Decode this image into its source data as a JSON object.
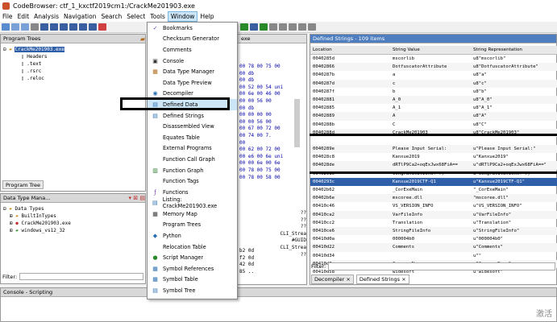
{
  "window": {
    "title": "CodeBrowser: ctf_1_kxctf2019cm1:/CrackMe201903.exe"
  },
  "menu": [
    "File",
    "Edit",
    "Analysis",
    "Navigation",
    "Search",
    "Select",
    "Tools",
    "Window",
    "Help"
  ],
  "program_trees": {
    "title": "Program Trees",
    "root": "CrackMe201903.exe",
    "children": [
      "Headers",
      ".text",
      ".rsrc",
      ".reloc"
    ],
    "tab": "Program Tree"
  },
  "data_type_manager": {
    "title": "Data Type Mana...",
    "root": "Data Types",
    "children": [
      "BuiltInTypes",
      "CrackMe201903.exe",
      "windows_vs12_32"
    ],
    "filter_label": "Filter:"
  },
  "console": {
    "title": "Console - Scripting"
  },
  "listing": {
    "tab": "exe",
    "lines": [
      "00  78 00 75 00",
      "00        db",
      "00        db",
      "00  52 00 54 uni",
      "00  6e 00 46 00",
      "00  00 56 00",
      "00        db",
      "00  00 00 00",
      "00  00 56 00",
      "00  67 00 72 00",
      "00  74 00 7.",
      "00",
      "00  62 00 72 00",
      "00  e6 00 6e uni",
      "00  00 6e 00 6e",
      "00  78 00 75 00",
      "00  78 00 58 00"
    ],
    "lower_lines": [
      "??",
      "??",
      "??",
      "CLI_Strea",
      "#GUID",
      "CLI_Strea",
      "??"
    ],
    "hex_lines": [
      "b2 0d",
      "f2 0d",
      "42 0d",
      "85 .."
    ]
  },
  "window_menu": {
    "items": [
      {
        "label": "Bookmarks",
        "icon": "✓",
        "color": "#6a3fb4"
      },
      {
        "label": "Checksum Generator",
        "icon": "",
        "color": "#000"
      },
      {
        "label": "Comments",
        "icon": "",
        "color": "#000"
      },
      {
        "label": "Console",
        "icon": "▣",
        "color": "#333"
      },
      {
        "label": "Data Type Manager",
        "icon": "▦",
        "color": "#b06a1a"
      },
      {
        "label": "Data Type Preview",
        "icon": "",
        "color": "#000"
      },
      {
        "label": "Decompiler",
        "icon": "◉",
        "color": "#2a6fb0"
      },
      {
        "label": "Defined Data",
        "icon": "▤",
        "color": "#2a6fb0"
      },
      {
        "label": "Defined Strings",
        "icon": "▤",
        "color": "#2a6fb0"
      },
      {
        "label": "Disassembled View",
        "icon": "",
        "color": "#000"
      },
      {
        "label": "Equates Table",
        "icon": "",
        "color": "#000"
      },
      {
        "label": "External Programs",
        "icon": "",
        "color": "#000"
      },
      {
        "label": "Function Call Graph",
        "icon": "",
        "color": "#000"
      },
      {
        "label": "Function Graph",
        "icon": "▥",
        "color": "#2a7a2a"
      },
      {
        "label": "Function Tags",
        "icon": "",
        "color": "#000"
      },
      {
        "label": "Functions",
        "icon": "ƒ",
        "color": "#7a3fb4"
      },
      {
        "label": "Listing: CrackMe201903.exe",
        "icon": "▤",
        "color": "#2a6fb0"
      },
      {
        "label": "Memory Map",
        "icon": "▦",
        "color": "#333"
      },
      {
        "label": "Program Trees",
        "icon": "",
        "color": "#000"
      },
      {
        "label": "Python",
        "icon": "◆",
        "color": "#2a6fb0"
      },
      {
        "label": "Relocation Table",
        "icon": "",
        "color": "#000"
      },
      {
        "label": "Script Manager",
        "icon": "●",
        "color": "#2a8a2a"
      },
      {
        "label": "Symbol References",
        "icon": "▦",
        "color": "#2a6fb0"
      },
      {
        "label": "Symbol Table",
        "icon": "▦",
        "color": "#2a6fb0"
      },
      {
        "label": "Symbol Tree",
        "icon": "▤",
        "color": "#2a6fb0"
      }
    ]
  },
  "defined_strings": {
    "title": "Defined Strings - 109 items",
    "columns": [
      "Location",
      "String Value",
      "String Representation"
    ],
    "rows": [
      [
        "0040285d",
        "mscorlib",
        "u8\"mscorlib\""
      ],
      [
        "00402866",
        "DotfuscatorAttribute",
        "u8\"DotfuscatorAttribute\""
      ],
      [
        "0040287b",
        "a",
        "u8\"a\""
      ],
      [
        "0040287d",
        "c",
        "u8\"c\""
      ],
      [
        "0040287f",
        "b",
        "u8\"b\""
      ],
      [
        "00402881",
        "A_0",
        "u8\"A_0\""
      ],
      [
        "00402885",
        "A_1",
        "u8\"A_1\""
      ],
      [
        "00402889",
        "A",
        "u8\"A\""
      ],
      [
        "0040288b",
        "C",
        "u8\"C\""
      ],
      [
        "0040288d",
        "CrackMe201903",
        "u8\"CrackMe201903\""
      ],
      [
        "",
        "",
        ""
      ],
      [
        "0040289e",
        "Please Input Serial:",
        "u\"Please Input Serial:\""
      ],
      [
        "004028c8",
        "Kanxue2019",
        "u\"Kanxue2019\""
      ],
      [
        "004028de",
        "dRTlP9Ca2+oqExJwx68FiA==",
        "u\"dRTlP9Ca2+oqExJwx68FiA==\""
      ],
      [
        "00402910",
        "Congratulations! :)",
        "u\"Congratulations! :)\""
      ],
      [
        "0040293c",
        "Kanxue2019CTF-Q1",
        "u\"Kanxue2019CTF-Q1\""
      ],
      [
        "00402b62",
        "_CorExeMain",
        "\"_CorExeMain\""
      ],
      [
        "00402b6e",
        "mscoree.dll",
        "\"mscoree.dll\""
      ],
      [
        "00410c46",
        "VS_VERSION_INFO",
        "u\"VS_VERSION_INFO\""
      ],
      [
        "00410ca2",
        "VarFileInfo",
        "u\"VarFileInfo\""
      ],
      [
        "00410cc2",
        "Translation",
        "u\"Translation\""
      ],
      [
        "00410ce6",
        "StringFileInfo",
        "u\"StringFileInfo\""
      ],
      [
        "00410d0a",
        "000004b0",
        "u\"000004b0\""
      ],
      [
        "00410d22",
        "Comments",
        "u\"Comments\""
      ],
      [
        "00410d34",
        "",
        "u\"\""
      ],
      [
        "00410d3e",
        "CompanyName",
        "u\"CompanyName\""
      ],
      [
        "00410d58",
        "widesoft",
        "u\"widesoft\""
      ]
    ],
    "filter_label": "Filter:",
    "bottom_tabs": [
      "Decompiler",
      "Defined Strings"
    ]
  },
  "watermark": "激活"
}
